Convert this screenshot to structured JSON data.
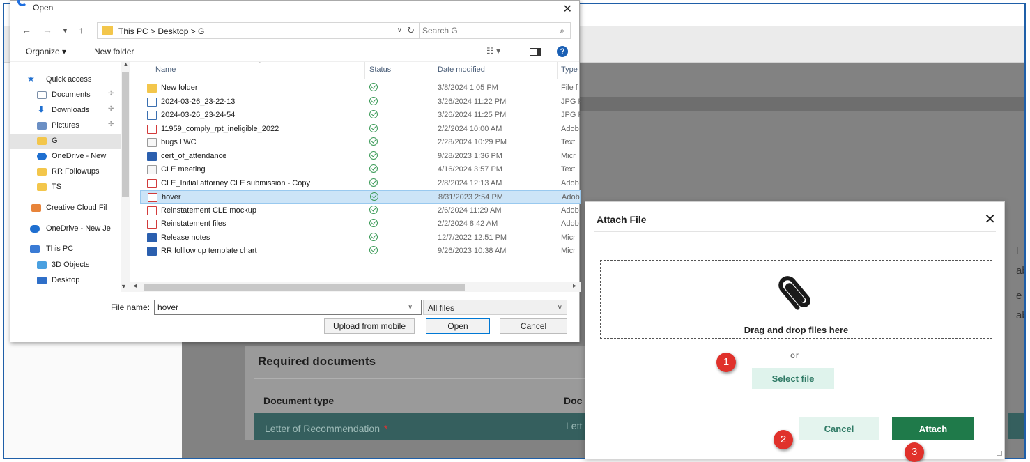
{
  "open_dialog": {
    "title": "Open",
    "address": "This PC  >  Desktop  >  G",
    "search_placeholder": "Search G",
    "toolbar": {
      "organize": "Organize ▾",
      "new_folder": "New folder"
    },
    "nav_items": [
      {
        "label": "Quick access",
        "icon": "star-icon"
      },
      {
        "label": "Documents",
        "icon": "documents-icon"
      },
      {
        "label": "Downloads",
        "icon": "download-icon"
      },
      {
        "label": "Pictures",
        "icon": "pictures-icon"
      },
      {
        "label": "G",
        "icon": "folder-icon",
        "selected": true
      },
      {
        "label": "OneDrive - New",
        "icon": "cloud-icon"
      },
      {
        "label": "RR Followups",
        "icon": "folder-icon"
      },
      {
        "label": "TS",
        "icon": "folder-icon"
      },
      {
        "label": "Creative Cloud Fil",
        "icon": "creative-cloud-icon"
      },
      {
        "label": "OneDrive - New Je",
        "icon": "cloud-icon"
      },
      {
        "label": "This PC",
        "icon": "computer-icon"
      },
      {
        "label": "3D Objects",
        "icon": "cube-icon"
      },
      {
        "label": "Desktop",
        "icon": "desktop-icon"
      }
    ],
    "columns": {
      "name": "Name",
      "status": "Status",
      "date": "Date modified",
      "type": "Type"
    },
    "files": [
      {
        "name": "New folder",
        "date": "3/8/2024 1:05 PM",
        "type": "File f",
        "icon": "folder"
      },
      {
        "name": "2024-03-26_23-22-13",
        "date": "3/26/2024 11:22 PM",
        "type": "JPG F",
        "icon": "jpg"
      },
      {
        "name": "2024-03-26_23-24-54",
        "date": "3/26/2024 11:25 PM",
        "type": "JPG F",
        "icon": "jpg"
      },
      {
        "name": "11959_comply_rpt_ineligible_2022",
        "date": "2/2/2024 10:00 AM",
        "type": "Adob",
        "icon": "pdf"
      },
      {
        "name": "bugs LWC",
        "date": "2/28/2024 10:29 PM",
        "type": "Text",
        "icon": "txt"
      },
      {
        "name": "cert_of_attendance",
        "date": "9/28/2023 1:36 PM",
        "type": "Micr",
        "icon": "doc"
      },
      {
        "name": "CLE meeting",
        "date": "4/16/2024 3:57 PM",
        "type": "Text",
        "icon": "txt"
      },
      {
        "name": "CLE_Initial attorney CLE submission - Copy",
        "date": "2/8/2024 12:13 AM",
        "type": "Adob",
        "icon": "pdf"
      },
      {
        "name": "hover",
        "date": "8/31/2023 2:54 PM",
        "type": "Adob",
        "icon": "pdf",
        "selected": true
      },
      {
        "name": "Reinstatement CLE mockup",
        "date": "2/6/2024 11:29 AM",
        "type": "Adob",
        "icon": "pdf"
      },
      {
        "name": "Reinstatement files",
        "date": "2/2/2024 8:42 AM",
        "type": "Adob",
        "icon": "pdf"
      },
      {
        "name": "Release notes",
        "date": "12/7/2022 12:51 PM",
        "type": "Micr",
        "icon": "doc"
      },
      {
        "name": "RR folllow up template chart",
        "date": "9/26/2023 10:38 AM",
        "type": "Micr",
        "icon": "doc"
      }
    ],
    "file_name_label": "File name:",
    "file_name_value": "hover",
    "file_type": "All files",
    "buttons": {
      "upload_mobile": "Upload from mobile",
      "open": "Open",
      "cancel": "Cancel"
    }
  },
  "attach_modal": {
    "title": "Attach File",
    "drop_text": "Drag and drop files here",
    "or_text": "or",
    "select_file": "Select file",
    "cancel": "Cancel",
    "attach": "Attach"
  },
  "step_markers": [
    "1",
    "2",
    "3"
  ],
  "background_page": {
    "section_title": "Required documents",
    "col_document_type": "Document type",
    "col_document": "Doc",
    "row_document_type": "Letter of Recommendation",
    "row_required_marker": "*",
    "row_document": "Lett",
    "edge_fragments": [
      "l",
      "ab",
      "e",
      "ab"
    ]
  },
  "colors": {
    "accent_green": "#1f7a4a",
    "select_green_bg": "#dff3ec",
    "selection_blue": "#cce4f7",
    "step_red": "#e0312b"
  }
}
